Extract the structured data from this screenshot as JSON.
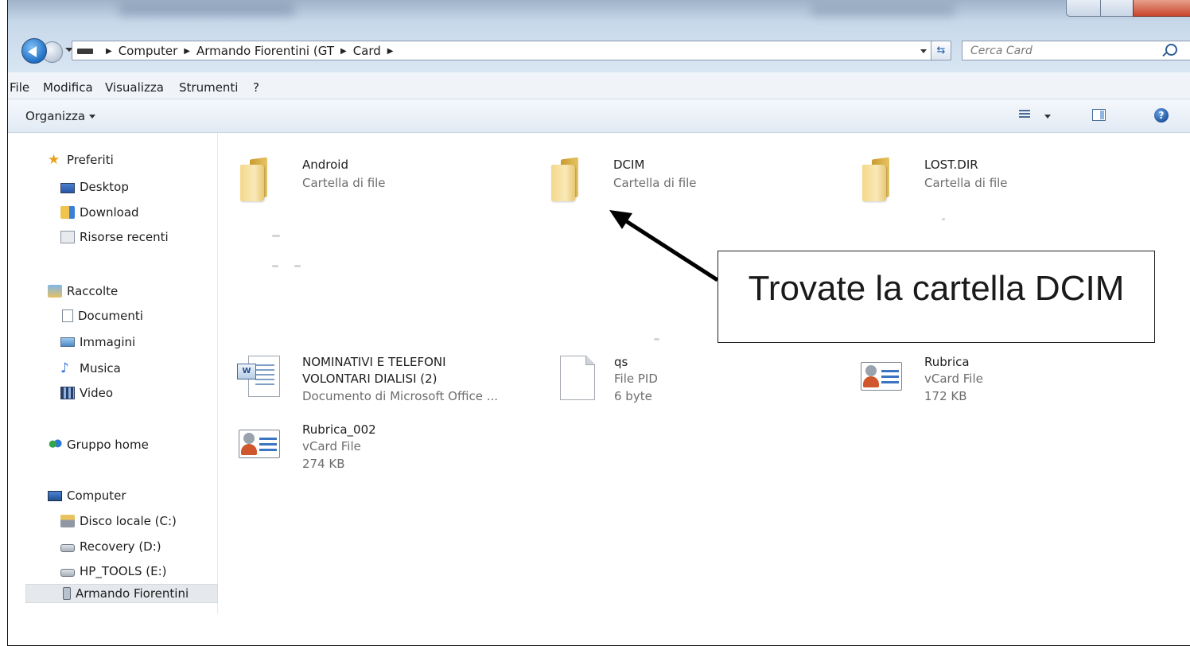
{
  "address": {
    "crumbs": [
      "Computer",
      "Armando Fiorentini (GT",
      "Card"
    ],
    "search_placeholder": "Cerca Card"
  },
  "menu": {
    "file": "File",
    "edit": "Modifica",
    "view": "Visualizza",
    "tools": "Strumenti",
    "help": "?"
  },
  "toolbar": {
    "organize": "Organizza",
    "help_glyph": "?"
  },
  "sidebar": {
    "favorites": "Preferiti",
    "desktop": "Desktop",
    "download": "Download",
    "recent": "Risorse recenti",
    "libraries": "Raccolte",
    "documents": "Documenti",
    "pictures": "Immagini",
    "music": "Musica",
    "video": "Video",
    "homegroup": "Gruppo home",
    "computer": "Computer",
    "local_disk": "Disco locale (C:)",
    "recovery": "Recovery (D:)",
    "hp_tools": "HP_TOOLS (E:)",
    "device": "Armando Fiorentini"
  },
  "files": {
    "android": {
      "name": "Android",
      "type": "Cartella di file"
    },
    "dcim": {
      "name": "DCIM",
      "type": "Cartella di file"
    },
    "lostdir": {
      "name": "LOST.DIR",
      "type": "Cartella di file"
    },
    "nominativi": {
      "name1": "NOMINATIVI E TELEFONI",
      "name2": "VOLONTARI DIALISI (2)",
      "type": "Documento di Microsoft Office ..."
    },
    "qs": {
      "name": "qs",
      "type": "File PID",
      "size": "6 byte"
    },
    "rubrica": {
      "name": "Rubrica",
      "type": "vCard File",
      "size": "172 KB"
    },
    "rubrica002": {
      "name": "Rubrica_002",
      "type": "vCard File",
      "size": "274 KB"
    }
  },
  "annotation": {
    "text": "Trovate la cartella DCIM"
  }
}
